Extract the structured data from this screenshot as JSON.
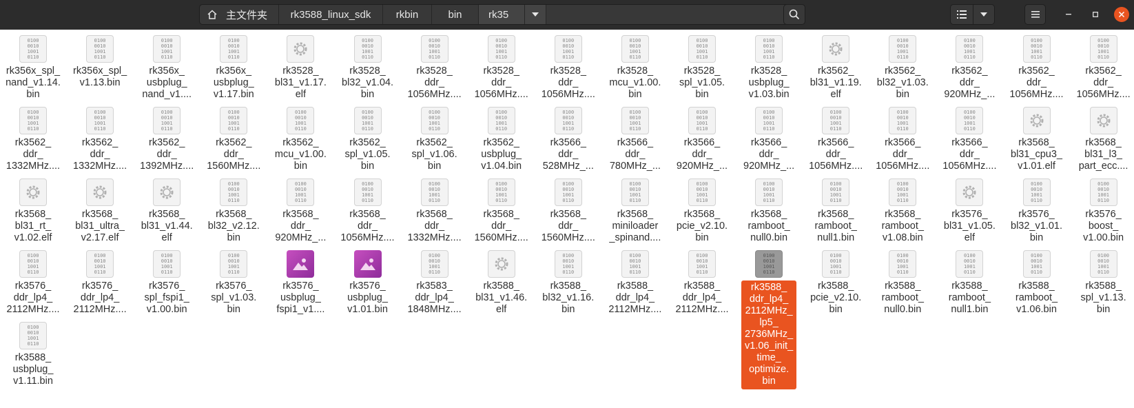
{
  "header": {
    "breadcrumbs": [
      "主文件夹",
      "rk3588_linux_sdk",
      "rkbin",
      "bin",
      "rk35"
    ],
    "accent_color": "#e95420"
  },
  "icons": {
    "home": "home-icon",
    "search": "search-icon",
    "list_view": "list-view-icon",
    "view_dropdown": "chevron-down-icon",
    "menu": "hamburger-menu-icon",
    "minimize": "minimize-icon",
    "maximize": "maximize-icon",
    "close": "close-icon"
  },
  "files": [
    {
      "name": "rk356x_spl_\nnand_v1.14.\nbin",
      "type": "bin"
    },
    {
      "name": "rk356x_spl_\nv1.13.bin",
      "type": "bin"
    },
    {
      "name": "rk356x_\nusbplug_\nnand_v1....",
      "type": "bin"
    },
    {
      "name": "rk356x_\nusbplug_\nv1.17.bin",
      "type": "bin"
    },
    {
      "name": "rk3528_\nbl31_v1.17.\nelf",
      "type": "elf"
    },
    {
      "name": "rk3528_\nbl32_v1.04.\nbin",
      "type": "bin"
    },
    {
      "name": "rk3528_\nddr_\n1056MHz....",
      "type": "bin"
    },
    {
      "name": "rk3528_\nddr_\n1056MHz....",
      "type": "bin"
    },
    {
      "name": "rk3528_\nddr_\n1056MHz....",
      "type": "bin"
    },
    {
      "name": "rk3528_\nmcu_v1.00.\nbin",
      "type": "bin"
    },
    {
      "name": "rk3528_\nspl_v1.05.\nbin",
      "type": "bin"
    },
    {
      "name": "rk3528_\nusbplug_\nv1.03.bin",
      "type": "bin"
    },
    {
      "name": "rk3562_\nbl31_v1.19.\nelf",
      "type": "elf"
    },
    {
      "name": "rk3562_\nbl32_v1.03.\nbin",
      "type": "bin"
    },
    {
      "name": "rk3562_\nddr_\n920MHz_...",
      "type": "bin"
    },
    {
      "name": "rk3562_\nddr_\n1056MHz....",
      "type": "bin"
    },
    {
      "name": "rk3562_\nddr_\n1056MHz....",
      "type": "bin"
    },
    {
      "name": "rk3562_\nddr_\n1332MHz....",
      "type": "bin"
    },
    {
      "name": "rk3562_\nddr_\n1332MHz....",
      "type": "bin"
    },
    {
      "name": "rk3562_\nddr_\n1392MHz....",
      "type": "bin"
    },
    {
      "name": "rk3562_\nddr_\n1560MHz....",
      "type": "bin"
    },
    {
      "name": "rk3562_\nmcu_v1.00.\nbin",
      "type": "bin"
    },
    {
      "name": "rk3562_\nspl_v1.05.\nbin",
      "type": "bin"
    },
    {
      "name": "rk3562_\nspl_v1.06.\nbin",
      "type": "bin"
    },
    {
      "name": "rk3562_\nusbplug_\nv1.04.bin",
      "type": "bin"
    },
    {
      "name": "rk3566_\nddr_\n528MHz_...",
      "type": "bin"
    },
    {
      "name": "rk3566_\nddr_\n780MHz_...",
      "type": "bin"
    },
    {
      "name": "rk3566_\nddr_\n920MHz_...",
      "type": "bin"
    },
    {
      "name": "rk3566_\nddr_\n920MHz_...",
      "type": "bin"
    },
    {
      "name": "rk3566_\nddr_\n1056MHz....",
      "type": "bin"
    },
    {
      "name": "rk3566_\nddr_\n1056MHz....",
      "type": "bin"
    },
    {
      "name": "rk3566_\nddr_\n1056MHz....",
      "type": "bin"
    },
    {
      "name": "rk3568_\nbl31_cpu3_\nv1.01.elf",
      "type": "elf"
    },
    {
      "name": "rk3568_\nbl31_l3_\npart_ecc....",
      "type": "elf"
    },
    {
      "name": "rk3568_\nbl31_rt_\nv1.02.elf",
      "type": "elf"
    },
    {
      "name": "rk3568_\nbl31_ultra_\nv2.17.elf",
      "type": "elf"
    },
    {
      "name": "rk3568_\nbl31_v1.44.\nelf",
      "type": "elf"
    },
    {
      "name": "rk3568_\nbl32_v2.12.\nbin",
      "type": "bin"
    },
    {
      "name": "rk3568_\nddr_\n920MHz_...",
      "type": "bin"
    },
    {
      "name": "rk3568_\nddr_\n1056MHz....",
      "type": "bin"
    },
    {
      "name": "rk3568_\nddr_\n1332MHz....",
      "type": "bin"
    },
    {
      "name": "rk3568_\nddr_\n1560MHz....",
      "type": "bin"
    },
    {
      "name": "rk3568_\nddr_\n1560MHz....",
      "type": "bin"
    },
    {
      "name": "rk3568_\nminiloader\n_spinand....",
      "type": "bin"
    },
    {
      "name": "rk3568_\npcie_v2.10.\nbin",
      "type": "bin"
    },
    {
      "name": "rk3568_\nramboot_\nnull0.bin",
      "type": "bin"
    },
    {
      "name": "rk3568_\nramboot_\nnull1.bin",
      "type": "bin"
    },
    {
      "name": "rk3568_\nramboot_\nv1.08.bin",
      "type": "bin"
    },
    {
      "name": "rk3576_\nbl31_v1.05.\nelf",
      "type": "elf"
    },
    {
      "name": "rk3576_\nbl32_v1.01.\nbin",
      "type": "bin"
    },
    {
      "name": "rk3576_\nboost_\nv1.00.bin",
      "type": "bin"
    },
    {
      "name": "rk3576_\nddr_lp4_\n2112MHz....",
      "type": "bin"
    },
    {
      "name": "rk3576_\nddr_lp4_\n2112MHz....",
      "type": "bin"
    },
    {
      "name": "rk3576_\nspl_fspi1_\nv1.00.bin",
      "type": "bin"
    },
    {
      "name": "rk3576_\nspl_v1.03.\nbin",
      "type": "bin"
    },
    {
      "name": "rk3576_\nusbplug_\nfspi1_v1....",
      "type": "image"
    },
    {
      "name": "rk3576_\nusbplug_\nv1.01.bin",
      "type": "image"
    },
    {
      "name": "rk3583_\nddr_lp4_\n1848MHz....",
      "type": "bin"
    },
    {
      "name": "rk3588_\nbl31_v1.46.\nelf",
      "type": "elf"
    },
    {
      "name": "rk3588_\nbl32_v1.16.\nbin",
      "type": "bin"
    },
    {
      "name": "rk3588_\nddr_lp4_\n2112MHz....",
      "type": "bin"
    },
    {
      "name": "rk3588_\nddr_lp4_\n2112MHz....",
      "type": "bin"
    },
    {
      "name": "rk3588_\nddr_lp4_\n2112MHz_\nlp5_\n2736MHz_\nv1.06_init_\ntime_\noptimize.\nbin",
      "type": "bin",
      "selected": true
    },
    {
      "name": "rk3588_\npcie_v2.10.\nbin",
      "type": "bin"
    },
    {
      "name": "rk3588_\nramboot_\nnull0.bin",
      "type": "bin"
    },
    {
      "name": "rk3588_\nramboot_\nnull1.bin",
      "type": "bin"
    },
    {
      "name": "rk3588_\nramboot_\nv1.06.bin",
      "type": "bin"
    },
    {
      "name": "rk3588_\nspl_v1.13.\nbin",
      "type": "bin"
    },
    {
      "name": "rk3588_\nusbplug_\nv1.11.bin",
      "type": "bin"
    }
  ]
}
